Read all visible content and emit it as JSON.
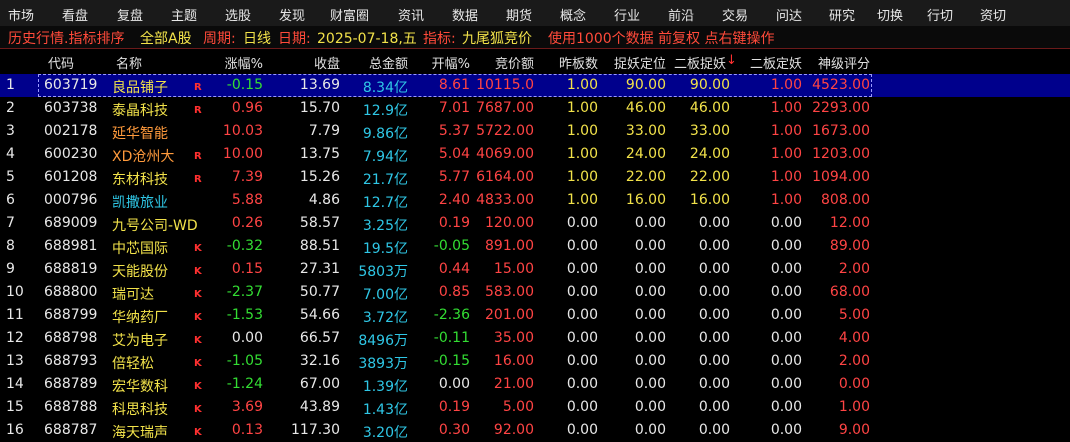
{
  "menu": [
    "市场",
    "看盘",
    "复盘",
    "主题",
    "选股",
    "发现",
    "财富圈",
    "资讯",
    "数据",
    "期货",
    "概念",
    "行业",
    "前沿",
    "交易",
    "问达",
    "研究",
    "切换",
    "行切",
    "资切"
  ],
  "info": {
    "title": "历史行情.指标排序",
    "scope": "全部A股",
    "period_label": "周期:",
    "period_value": "日线",
    "date_label": "日期:",
    "date_value": "2025-07-18,五",
    "indicator_label": "指标:",
    "indicator_value": "九尾狐竞价",
    "note": "使用1000个数据 前复权 点右键操作"
  },
  "columns": [
    "代码",
    "名称",
    "涨幅%",
    "收盘",
    "总金额",
    "开幅%",
    "竞价额",
    "昨板数",
    "捉妖定位",
    "二板捉妖",
    "二板定妖",
    "神级评分"
  ],
  "sort_arrow": "↓",
  "colors": {
    "yellow": "#f2e24a",
    "red": "#ff4444",
    "green": "#33dd33",
    "cyan": "#2fc7e6",
    "select": "#00008c"
  },
  "rows": [
    {
      "idx": "1",
      "code": "603719",
      "name": "良品铺子",
      "tag": "R",
      "chg": "-0.15",
      "close": "13.69",
      "amount": "8.34亿",
      "open": "8.61",
      "auction": "10115.0",
      "prev": "1.00",
      "zy": "90.00",
      "eb": "90.00",
      "ed": "1.00",
      "score": "4523.00",
      "selected": true
    },
    {
      "idx": "2",
      "code": "603738",
      "name": "泰晶科技",
      "tag": "R",
      "chg": "0.96",
      "close": "15.70",
      "amount": "12.9亿",
      "open": "7.01",
      "auction": "7687.00",
      "prev": "1.00",
      "zy": "46.00",
      "eb": "46.00",
      "ed": "1.00",
      "score": "2293.00"
    },
    {
      "idx": "3",
      "code": "002178",
      "name": "延华智能",
      "tag": "",
      "chg": "10.03",
      "close": "7.79",
      "amount": "9.86亿",
      "open": "5.37",
      "auction": "5722.00",
      "prev": "1.00",
      "zy": "33.00",
      "eb": "33.00",
      "ed": "1.00",
      "score": "1673.00",
      "name_color": "orange"
    },
    {
      "idx": "4",
      "code": "600230",
      "name": "XD沧州大",
      "tag": "R",
      "chg": "10.00",
      "close": "13.75",
      "amount": "7.94亿",
      "open": "5.04",
      "auction": "4069.00",
      "prev": "1.00",
      "zy": "24.00",
      "eb": "24.00",
      "ed": "1.00",
      "score": "1203.00",
      "name_color": "orange"
    },
    {
      "idx": "5",
      "code": "601208",
      "name": "东材科技",
      "tag": "R",
      "chg": "7.39",
      "close": "15.26",
      "amount": "21.7亿",
      "open": "5.77",
      "auction": "6164.00",
      "prev": "1.00",
      "zy": "22.00",
      "eb": "22.00",
      "ed": "1.00",
      "score": "1094.00"
    },
    {
      "idx": "6",
      "code": "000796",
      "name": "凯撒旅业",
      "tag": "",
      "chg": "5.88",
      "close": "4.86",
      "amount": "12.7亿",
      "open": "2.40",
      "auction": "4833.00",
      "prev": "1.00",
      "zy": "16.00",
      "eb": "16.00",
      "ed": "1.00",
      "score": "808.00",
      "name_color": "cyan"
    },
    {
      "idx": "7",
      "code": "689009",
      "name": "九号公司-WD",
      "tag": "",
      "chg": "0.26",
      "close": "58.57",
      "amount": "3.25亿",
      "open": "0.19",
      "auction": "120.00",
      "prev": "0.00",
      "zy": "0.00",
      "eb": "0.00",
      "ed": "0.00",
      "score": "12.00"
    },
    {
      "idx": "8",
      "code": "688981",
      "name": "中芯国际",
      "tag": "K",
      "chg": "-0.32",
      "close": "88.51",
      "amount": "19.5亿",
      "open": "-0.05",
      "auction": "891.00",
      "prev": "0.00",
      "zy": "0.00",
      "eb": "0.00",
      "ed": "0.00",
      "score": "89.00"
    },
    {
      "idx": "9",
      "code": "688819",
      "name": "天能股份",
      "tag": "K",
      "chg": "0.15",
      "close": "27.31",
      "amount": "5803万",
      "open": "0.44",
      "auction": "15.00",
      "prev": "0.00",
      "zy": "0.00",
      "eb": "0.00",
      "ed": "0.00",
      "score": "2.00"
    },
    {
      "idx": "10",
      "code": "688800",
      "name": "瑞可达",
      "tag": "K",
      "chg": "-2.37",
      "close": "50.77",
      "amount": "7.00亿",
      "open": "0.85",
      "auction": "583.00",
      "prev": "0.00",
      "zy": "0.00",
      "eb": "0.00",
      "ed": "0.00",
      "score": "68.00"
    },
    {
      "idx": "11",
      "code": "688799",
      "name": "华纳药厂",
      "tag": "K",
      "chg": "-1.53",
      "close": "54.66",
      "amount": "3.72亿",
      "open": "-2.36",
      "auction": "201.00",
      "prev": "0.00",
      "zy": "0.00",
      "eb": "0.00",
      "ed": "0.00",
      "score": "5.00"
    },
    {
      "idx": "12",
      "code": "688798",
      "name": "艾为电子",
      "tag": "K",
      "chg": "0.00",
      "close": "66.57",
      "amount": "8496万",
      "open": "-0.11",
      "auction": "35.00",
      "prev": "0.00",
      "zy": "0.00",
      "eb": "0.00",
      "ed": "0.00",
      "score": "4.00"
    },
    {
      "idx": "13",
      "code": "688793",
      "name": "倍轻松",
      "tag": "K",
      "chg": "-1.05",
      "close": "32.16",
      "amount": "3893万",
      "open": "-0.15",
      "auction": "16.00",
      "prev": "0.00",
      "zy": "0.00",
      "eb": "0.00",
      "ed": "0.00",
      "score": "2.00"
    },
    {
      "idx": "14",
      "code": "688789",
      "name": "宏华数科",
      "tag": "K",
      "chg": "-1.24",
      "close": "67.00",
      "amount": "1.39亿",
      "open": "0.00",
      "auction": "21.00",
      "prev": "0.00",
      "zy": "0.00",
      "eb": "0.00",
      "ed": "0.00",
      "score": "0.00"
    },
    {
      "idx": "15",
      "code": "688788",
      "name": "科思科技",
      "tag": "K",
      "chg": "3.69",
      "close": "43.89",
      "amount": "1.43亿",
      "open": "0.19",
      "auction": "5.00",
      "prev": "0.00",
      "zy": "0.00",
      "eb": "0.00",
      "ed": "0.00",
      "score": "1.00"
    },
    {
      "idx": "16",
      "code": "688787",
      "name": "海天瑞声",
      "tag": "K",
      "chg": "0.13",
      "close": "117.30",
      "amount": "3.20亿",
      "open": "0.30",
      "auction": "92.00",
      "prev": "0.00",
      "zy": "0.00",
      "eb": "0.00",
      "ed": "0.00",
      "score": "9.00"
    }
  ]
}
